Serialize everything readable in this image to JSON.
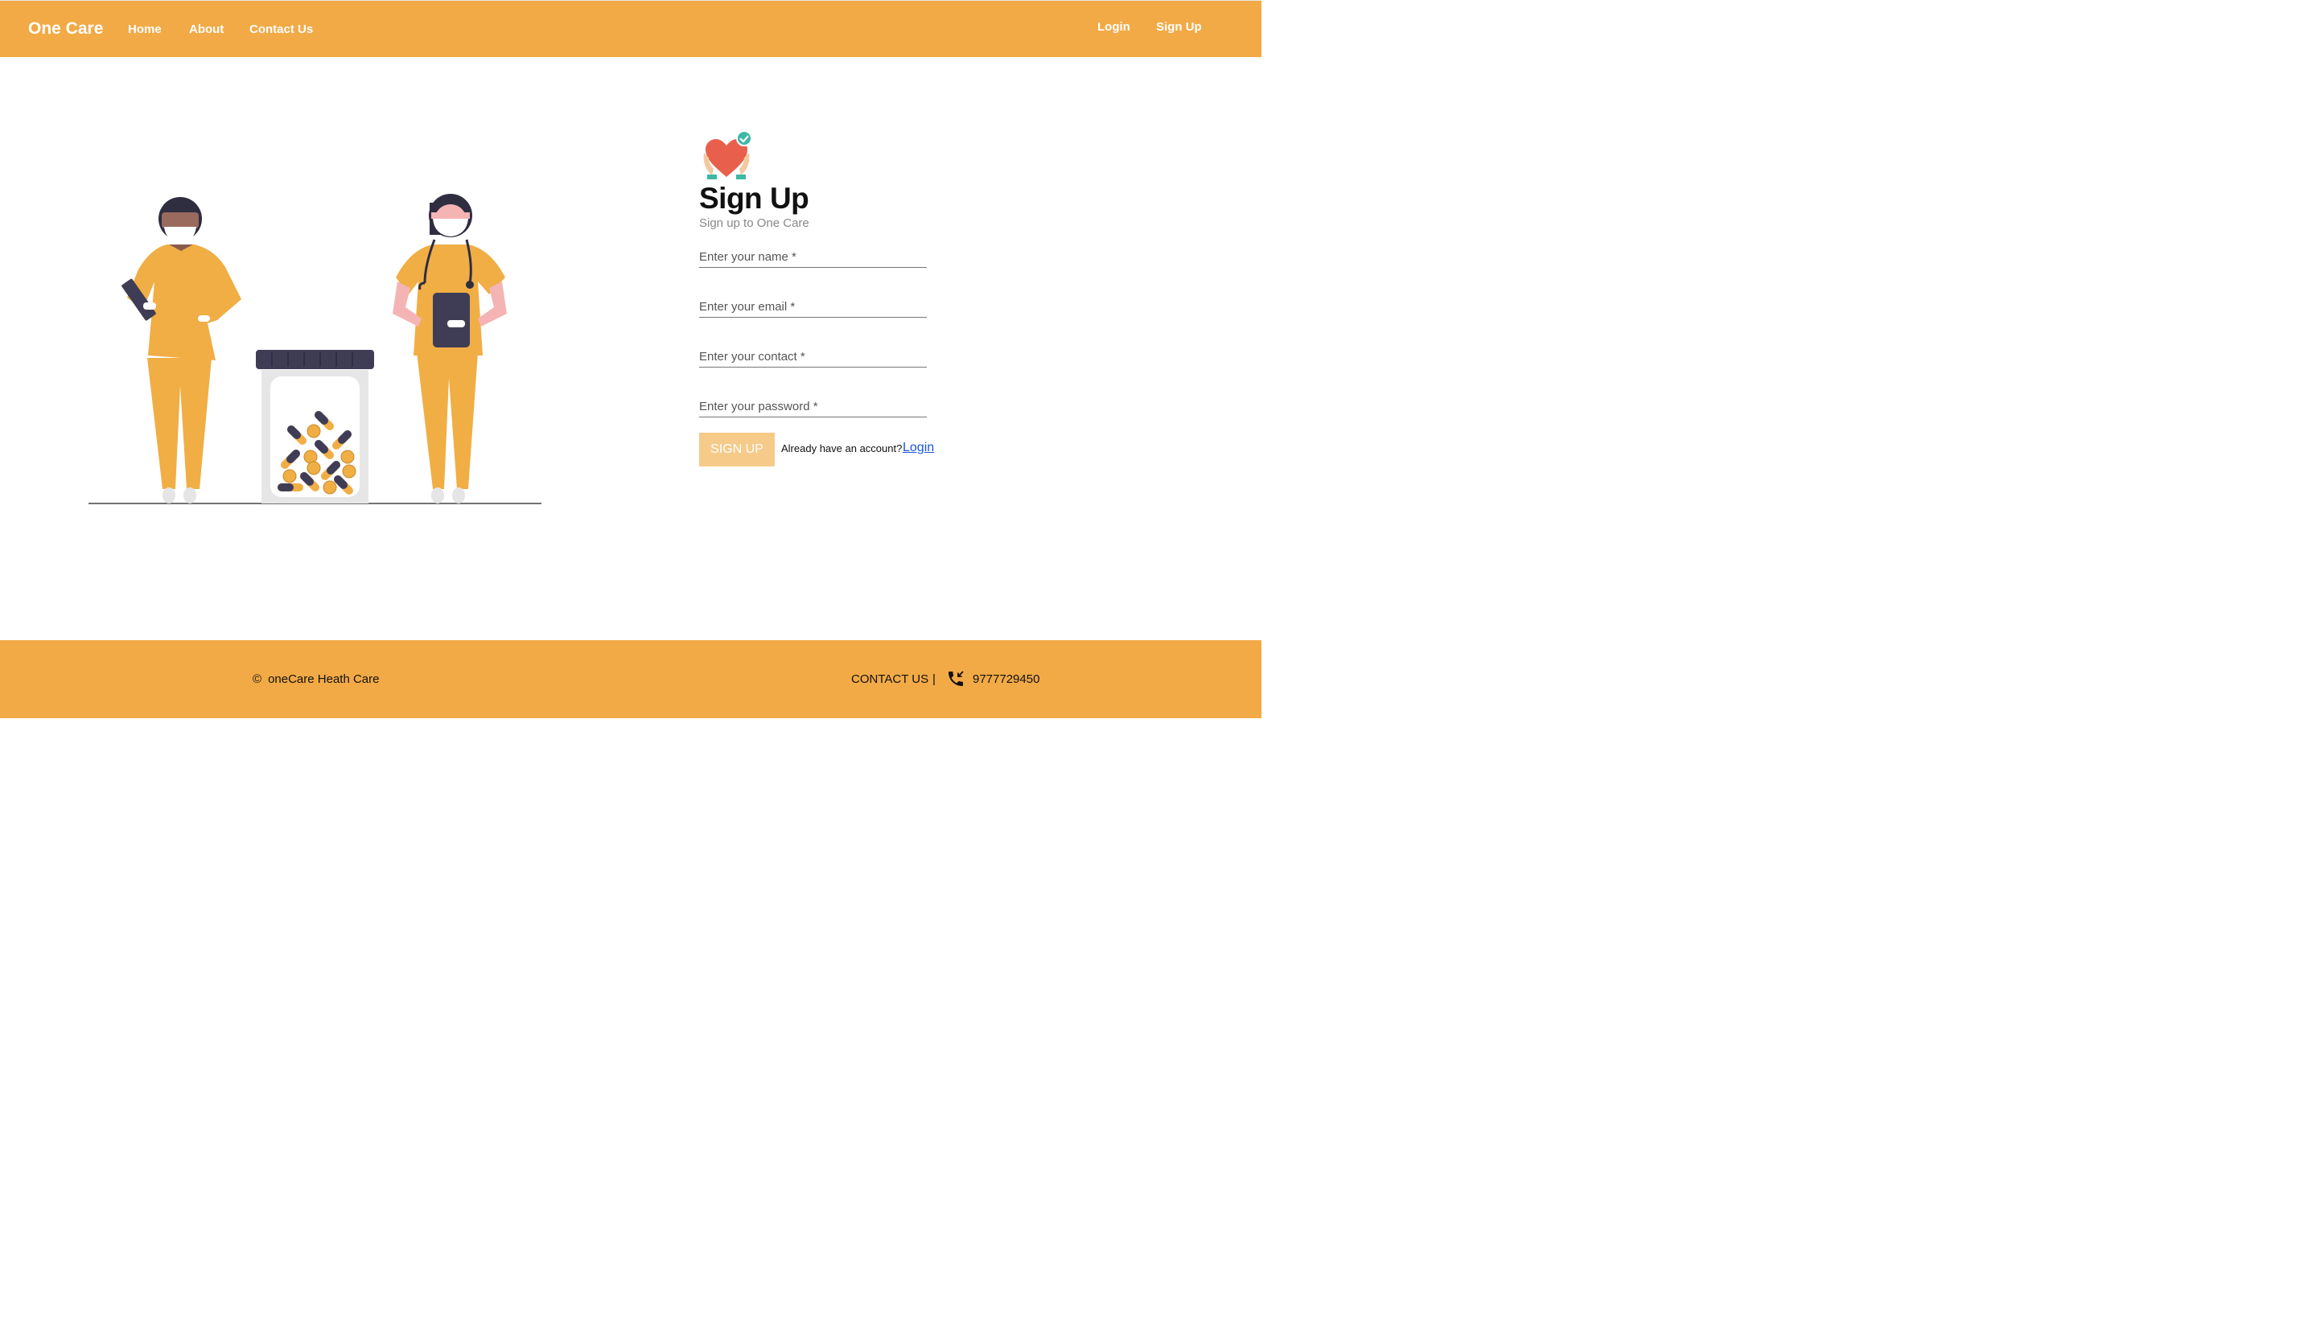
{
  "nav": {
    "brand": "One Care",
    "links": [
      "Home",
      "About",
      "Contact Us"
    ],
    "login": "Login",
    "signup": "Sign Up"
  },
  "form": {
    "title": "Sign Up",
    "subtitle": "Sign up to One Care",
    "name_placeholder": "Enter your name *",
    "email_placeholder": "Enter your email *",
    "contact_placeholder": "Enter your contact *",
    "password_placeholder": "Enter your password *",
    "submit_label": "SIGN UP",
    "login_prompt": "Already have an account?",
    "login_link": "Login"
  },
  "footer": {
    "copyright_symbol": "©",
    "copyright": "oneCare Heath Care",
    "contact_label": "CONTACT US",
    "divider": "|",
    "phone": "9777729450"
  },
  "colors": {
    "brand": "#F2AA46",
    "button": "#F6CA89",
    "link": "#1a56db"
  }
}
